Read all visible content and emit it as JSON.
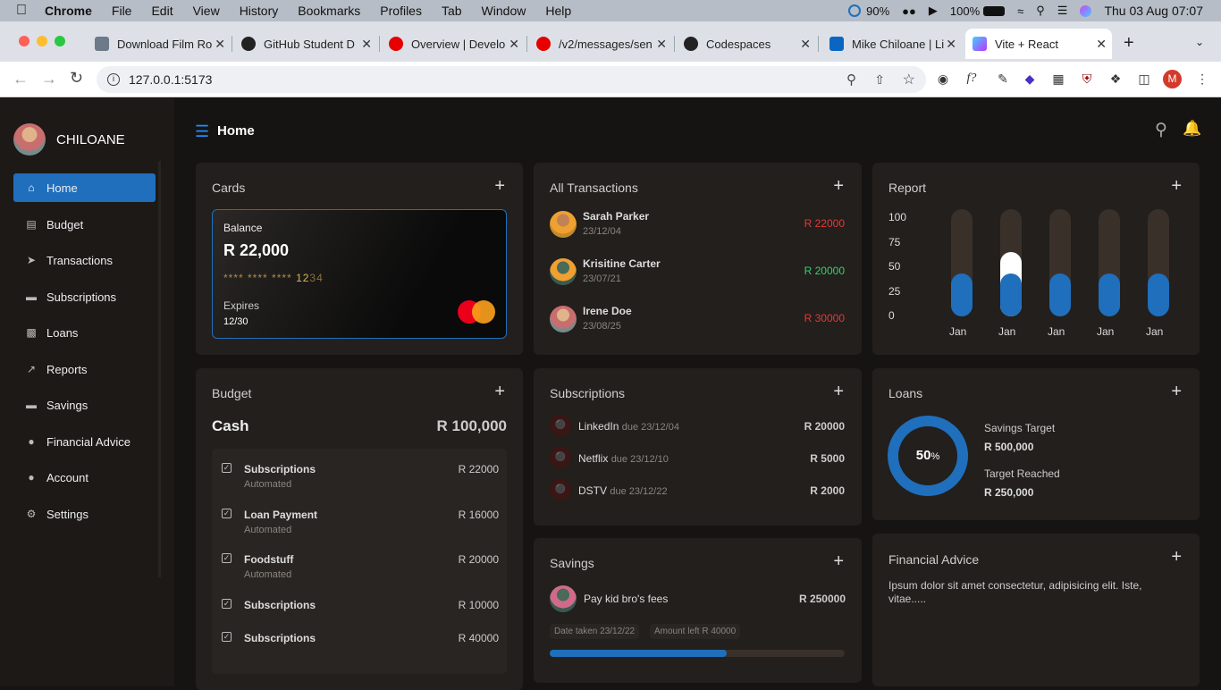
{
  "menubar": {
    "app": "Chrome",
    "menus": [
      "File",
      "Edit",
      "View",
      "History",
      "Bookmarks",
      "Profiles",
      "Tab",
      "Window",
      "Help"
    ],
    "status": {
      "percent1": "90%",
      "battery": "100%",
      "datetime": "Thu 03 Aug  07:07"
    }
  },
  "tabs": [
    {
      "title": "Download Film Ro",
      "icon": "doc-icon"
    },
    {
      "title": "GitHub Student D",
      "icon": "github-icon"
    },
    {
      "title": "Overview | Develo",
      "icon": "opera-icon"
    },
    {
      "title": "/v2/messages/sen",
      "icon": "opera-icon"
    },
    {
      "title": "Codespaces",
      "icon": "github-icon"
    },
    {
      "title": "Mike Chiloane | Li",
      "icon": "linkedin-icon"
    },
    {
      "title": "Vite + React",
      "icon": "vite-icon"
    }
  ],
  "address": {
    "url": "127.0.0.1:5173",
    "profile_initial": "M"
  },
  "sidebar": {
    "brand": "CHILOANE",
    "items": [
      {
        "label": "Home",
        "icon": "home-icon"
      },
      {
        "label": "Budget",
        "icon": "clipboard-icon"
      },
      {
        "label": "Transactions",
        "icon": "send-icon"
      },
      {
        "label": "Subscriptions",
        "icon": "card-icon"
      },
      {
        "label": "Loans",
        "icon": "wallet-icon"
      },
      {
        "label": "Reports",
        "icon": "chart-icon"
      },
      {
        "label": "Savings",
        "icon": "piggy-icon"
      },
      {
        "label": "Financial Advice",
        "icon": "coin-icon"
      },
      {
        "label": "Account",
        "icon": "user-icon"
      },
      {
        "label": "Settings",
        "icon": "gear-icon"
      }
    ]
  },
  "header": {
    "title": "Home"
  },
  "cards": {
    "title": "Cards",
    "balance_label": "Balance",
    "balance": "R 22,000",
    "masked": "**** **** ****",
    "last4_a": "12",
    "last4_b": "34",
    "expires_label": "Expires",
    "expires": "12/30"
  },
  "transactions": {
    "title": "All Transactions",
    "items": [
      {
        "name": "Sarah Parker",
        "date": "23/12/04",
        "amount": "R 22000",
        "status": "red"
      },
      {
        "name": "Krisitine Carter",
        "date": "23/07/21",
        "amount": "R 20000",
        "status": "green"
      },
      {
        "name": "Irene Doe",
        "date": "23/08/25",
        "amount": "R 30000",
        "status": "red"
      }
    ]
  },
  "report": {
    "title": "Report"
  },
  "chart_data": {
    "type": "bar",
    "categories": [
      "Jan",
      "Jan",
      "Jan",
      "Jan",
      "Jan"
    ],
    "yticks": [
      100,
      75,
      50,
      25,
      0
    ],
    "ylim": [
      0,
      100
    ],
    "series": [
      {
        "values": [
          40,
          40,
          40,
          40,
          40
        ],
        "color": "#1f6fbd"
      },
      {
        "values": [
          0,
          20,
          0,
          0,
          0
        ],
        "color": "#ffffff"
      }
    ]
  },
  "budget": {
    "title": "Budget",
    "cash_label": "Cash",
    "cash_value": "R 100,000",
    "items": [
      {
        "name": "Subscriptions",
        "sub": "Automated",
        "amount": "R 22000"
      },
      {
        "name": "Loan Payment",
        "sub": "Automated",
        "amount": "R 16000"
      },
      {
        "name": "Foodstuff",
        "sub": "Automated",
        "amount": "R 20000"
      },
      {
        "name": "Subscriptions",
        "sub": "",
        "amount": "R 10000"
      },
      {
        "name": "Subscriptions",
        "sub": "",
        "amount": "R 40000"
      }
    ]
  },
  "subscriptions": {
    "title": "Subscriptions",
    "items": [
      {
        "name": "LinkedIn",
        "due": "due 23/12/04",
        "amount": "R 20000"
      },
      {
        "name": "Netflix",
        "due": "due 23/12/10",
        "amount": "R 5000"
      },
      {
        "name": "DSTV",
        "due": "due 23/12/22",
        "amount": "R 2000"
      }
    ]
  },
  "loans": {
    "title": "Loans",
    "percent": "50",
    "percent_unit": "%",
    "progress": 0.5,
    "savings_target_label": "Savings Target",
    "savings_target": "R 500,000",
    "target_reached_label": "Target Reached",
    "target_reached": "R 250,000"
  },
  "savings": {
    "title": "Savings",
    "item": "Pay kid bro's fees",
    "amount": "R 250000",
    "date_taken": "Date taken 23/12/22",
    "amount_left": "Amount left R 40000",
    "progress": 0.6
  },
  "advice": {
    "title": "Financial Advice",
    "text": "Ipsum dolor sit amet consectetur, adipisicing elit. Iste, vitae....."
  }
}
